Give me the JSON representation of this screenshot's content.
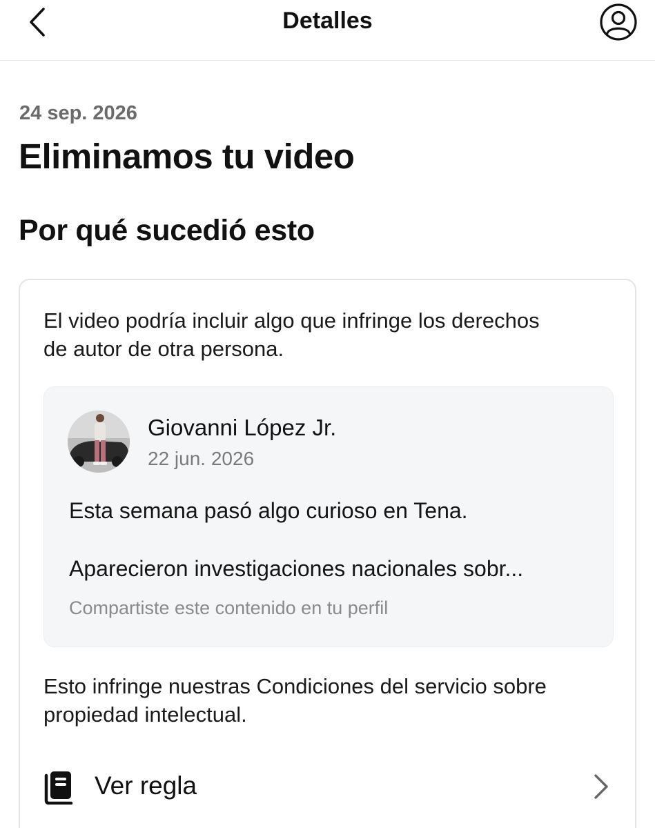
{
  "header": {
    "title": "Detalles",
    "back_icon": "chevron-left-icon",
    "profile_icon": "user-circle-icon"
  },
  "notice": {
    "date": "24 sep. 2026",
    "title": "Eliminamos tu video",
    "section_title": "Por qué sucedió esto"
  },
  "card": {
    "description": "El video podría incluir algo que infringe los derechos de autor de otra persona.",
    "post": {
      "author": "Giovanni López Jr.",
      "date": "22 jun. 2026",
      "line1": "Esta semana pasó algo curioso en Tena.",
      "line2": "Aparecieron investigaciones nacionales sobr...",
      "footer": "Compartiste este contenido en tu perfil"
    },
    "policy_text": "Esto infringe nuestras Condiciones del servicio sobre propiedad intelectual.",
    "rule": {
      "label": "Ver regla",
      "icon": "book-icon",
      "chevron": "chevron-right-icon"
    }
  },
  "colors": {
    "text": "#111111",
    "muted": "#6b6b6b",
    "card_border": "#e4e4e4",
    "post_background": "#f5f6f8"
  }
}
